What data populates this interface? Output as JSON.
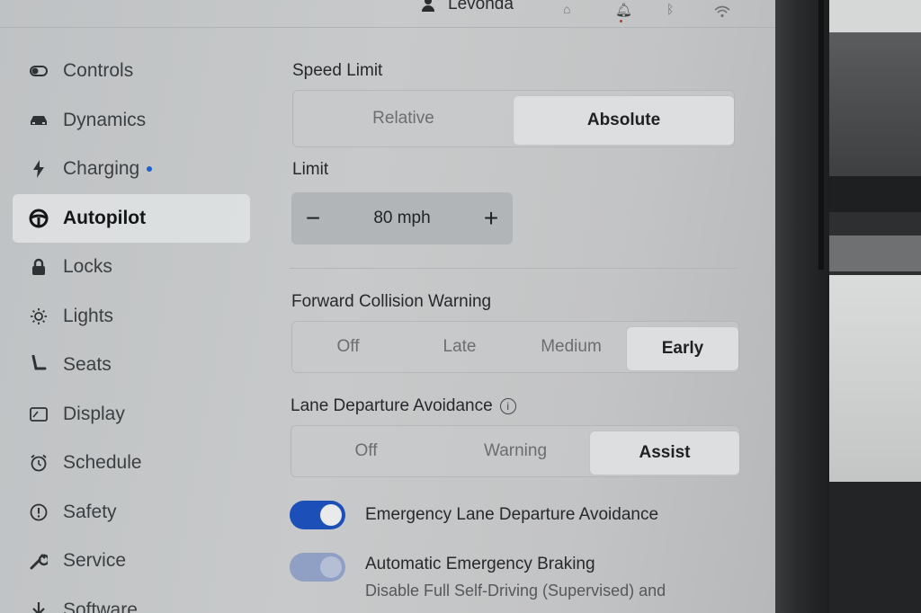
{
  "status": {
    "user_name": "Levonda",
    "icons": [
      "user-icon",
      "home-icon",
      "bell-icon",
      "bluetooth-icon",
      "wifi-icon"
    ]
  },
  "sidebar": {
    "items": [
      {
        "label": "Controls",
        "icon": "toggle-icon"
      },
      {
        "label": "Dynamics",
        "icon": "car-icon"
      },
      {
        "label": "Charging",
        "icon": "lightning-icon",
        "badge": true
      },
      {
        "label": "Autopilot",
        "icon": "steering-wheel-icon",
        "active": true
      },
      {
        "label": "Locks",
        "icon": "lock-icon"
      },
      {
        "label": "Lights",
        "icon": "sun-icon"
      },
      {
        "label": "Seats",
        "icon": "seat-icon"
      },
      {
        "label": "Display",
        "icon": "display-icon"
      },
      {
        "label": "Schedule",
        "icon": "alarm-clock-icon"
      },
      {
        "label": "Safety",
        "icon": "alert-circle-icon"
      },
      {
        "label": "Service",
        "icon": "wrench-icon"
      },
      {
        "label": "Software",
        "icon": "download-icon"
      }
    ]
  },
  "speed_limit": {
    "label": "Speed Limit",
    "options": [
      "Relative",
      "Absolute"
    ],
    "selected": "Absolute"
  },
  "limit": {
    "label": "Limit",
    "value": "80 mph",
    "decrement": "−",
    "increment": "+"
  },
  "forward_collision": {
    "label": "Forward Collision Warning",
    "options": [
      "Off",
      "Late",
      "Medium",
      "Early"
    ],
    "selected": "Early"
  },
  "lane_departure": {
    "label": "Lane Departure Avoidance",
    "options": [
      "Off",
      "Warning",
      "Assist"
    ],
    "selected": "Assist"
  },
  "emergency_lane": {
    "label": "Emergency Lane Departure Avoidance",
    "on": true
  },
  "aeb": {
    "label": "Automatic Emergency Braking",
    "sub": "Disable Full Self-Driving (Supervised) and",
    "on": true,
    "disabled": true
  },
  "colors": {
    "accent": "#1c4fb8",
    "badge": "#1f5fcf"
  }
}
